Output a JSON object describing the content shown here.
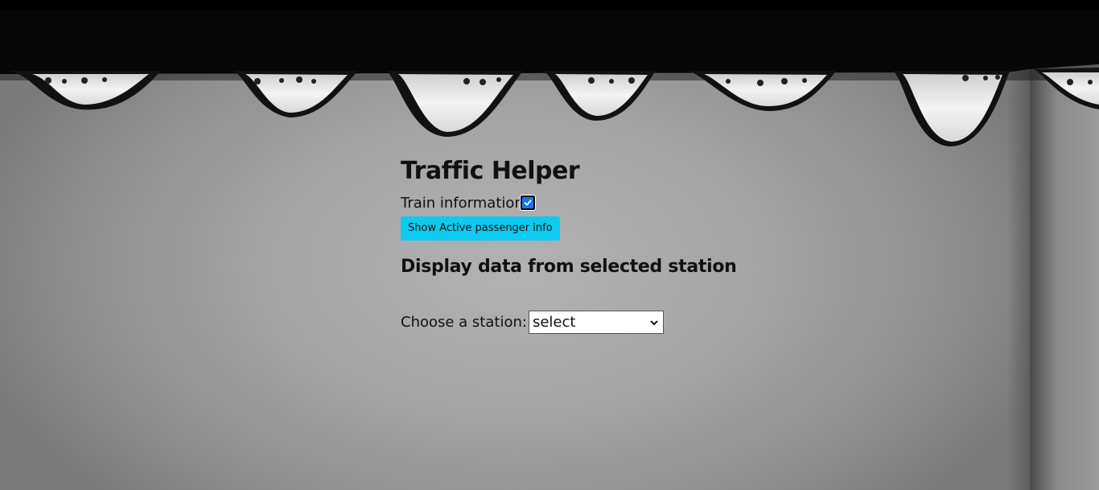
{
  "page": {
    "title": "Traffic Helper",
    "subtitle": "Display data from selected station"
  },
  "train_info": {
    "label": "Train information",
    "checked": true
  },
  "buttons": {
    "active_passenger": "Show Active passenger info"
  },
  "station": {
    "label": "Choose a station:",
    "selected": "select"
  },
  "colors": {
    "button_bg": "#0dcaf0",
    "checkbox_bg": "#1a73e8",
    "text": "#111111"
  },
  "icons": {
    "checkbox": "check-icon",
    "select": "chevron-down-icon"
  }
}
